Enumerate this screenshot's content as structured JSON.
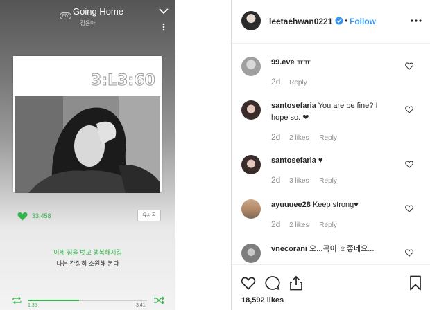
{
  "player": {
    "badge": "MV",
    "song_title": "Going Home",
    "artist": "김윤아",
    "album_logo_text": "3:L3:60",
    "like_count": "33,458",
    "similar_button": "유사곡",
    "lyric_active": "이제 짐을 벗고 행복해지길",
    "lyric_next": "나는 간절히 소원해 본다",
    "time_elapsed": "1:35",
    "time_total": "3:41",
    "progress_fraction": 0.43,
    "accent_color": "#32b44a"
  },
  "instagram": {
    "username": "leetaehwan0221",
    "follow_label": "Follow",
    "dot": "•",
    "comments": [
      {
        "user": "99.eve",
        "text": "ㅠㅠ",
        "time": "2d",
        "likes": "",
        "reply": "Reply"
      },
      {
        "user": "santosefaria",
        "text": "You are be fine? I hope so. ❤",
        "time": "2d",
        "likes": "2 likes",
        "reply": "Reply"
      },
      {
        "user": "santosefaria",
        "text": "♥",
        "time": "2d",
        "likes": "3 likes",
        "reply": "Reply"
      },
      {
        "user": "ayuuuee28",
        "text": "Keep strong♥",
        "time": "2d",
        "likes": "2 likes",
        "reply": "Reply"
      },
      {
        "user": "vnecorani",
        "text": "오...곡이 ☺좋네요...",
        "time": "",
        "likes": "",
        "reply": ""
      }
    ],
    "likes_total": "18,592 likes",
    "link_color": "#3897f0"
  }
}
